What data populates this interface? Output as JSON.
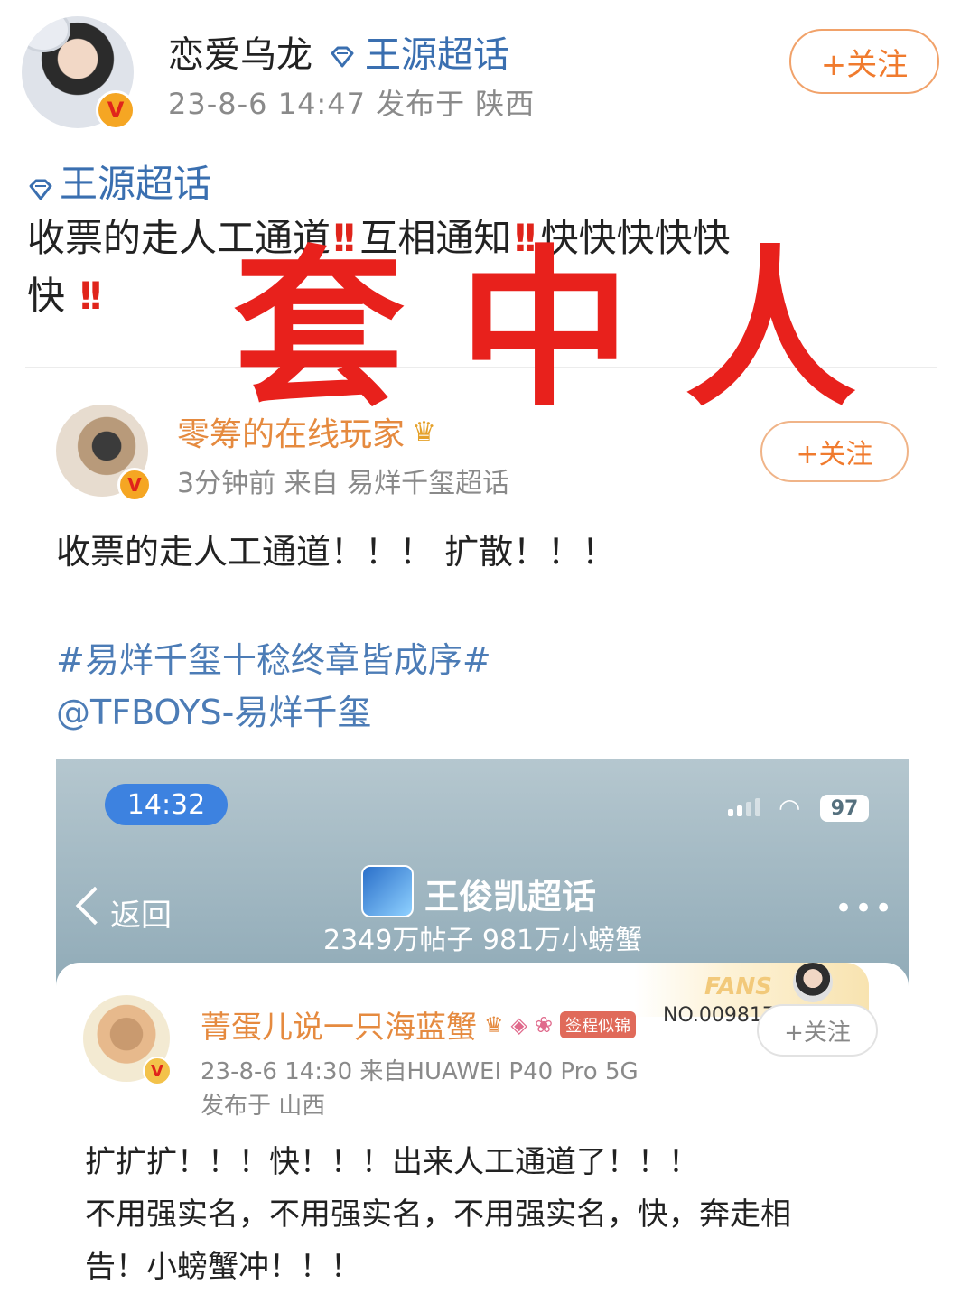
{
  "post": {
    "author": "恋爱乌龙",
    "topic_link": "王源超话",
    "meta": "23-8-6 14:47  发布于 陕西",
    "follow_label": "+关注",
    "topic_tag": "王源超话",
    "text_1": "收票的走人工通道",
    "text_2": "互相通知",
    "text_3": "快快快快快",
    "text_4": "快",
    "emphasis": "!!"
  },
  "overlay": {
    "text": "套中人",
    "color": "#e8211c"
  },
  "quoted": {
    "author": "零筹的在线玩家",
    "meta": "3分钟前  来自 易烊千玺超话",
    "follow_label": "+关注",
    "text": "收票的走人工通道！！！ 扩散！！！",
    "hashtag": "#易烊千玺十稔终章皆成序#",
    "mention": "@TFBOYS-易烊千玺"
  },
  "screenshot": {
    "time": "14:32",
    "battery": "97",
    "back_label": "返回",
    "title": "王俊凯超话",
    "stats": "2349万帖子 981万小螃蟹",
    "more": "•••",
    "fans_label": "FANS",
    "fans_no": "NO.009817",
    "card": {
      "author": "菁蛋儿说一只海蓝蟹",
      "badge_text": "签程似锦",
      "follow_label": "+关注",
      "meta": "23-8-6 14:30  来自HUAWEI P40 Pro 5G",
      "location": "发布于 山西",
      "text_line1": "扩扩扩！！！快！！！出来人工通道了！！！",
      "text_line2": "不用强实名，不用强实名，不用强实名，快，奔走相",
      "text_line3": "告！小螃蟹冲！！！"
    }
  },
  "colors": {
    "link_blue": "#3a6fb0",
    "follow_orange": "#f07b2e",
    "author_orange": "#e58a3f",
    "alert_red": "#e0241b"
  },
  "icons": [
    "diamond-icon",
    "verified-badge-icon",
    "crown-icon",
    "chevron-left-icon",
    "wifi-icon",
    "signal-icon",
    "battery-icon",
    "more-icon"
  ]
}
